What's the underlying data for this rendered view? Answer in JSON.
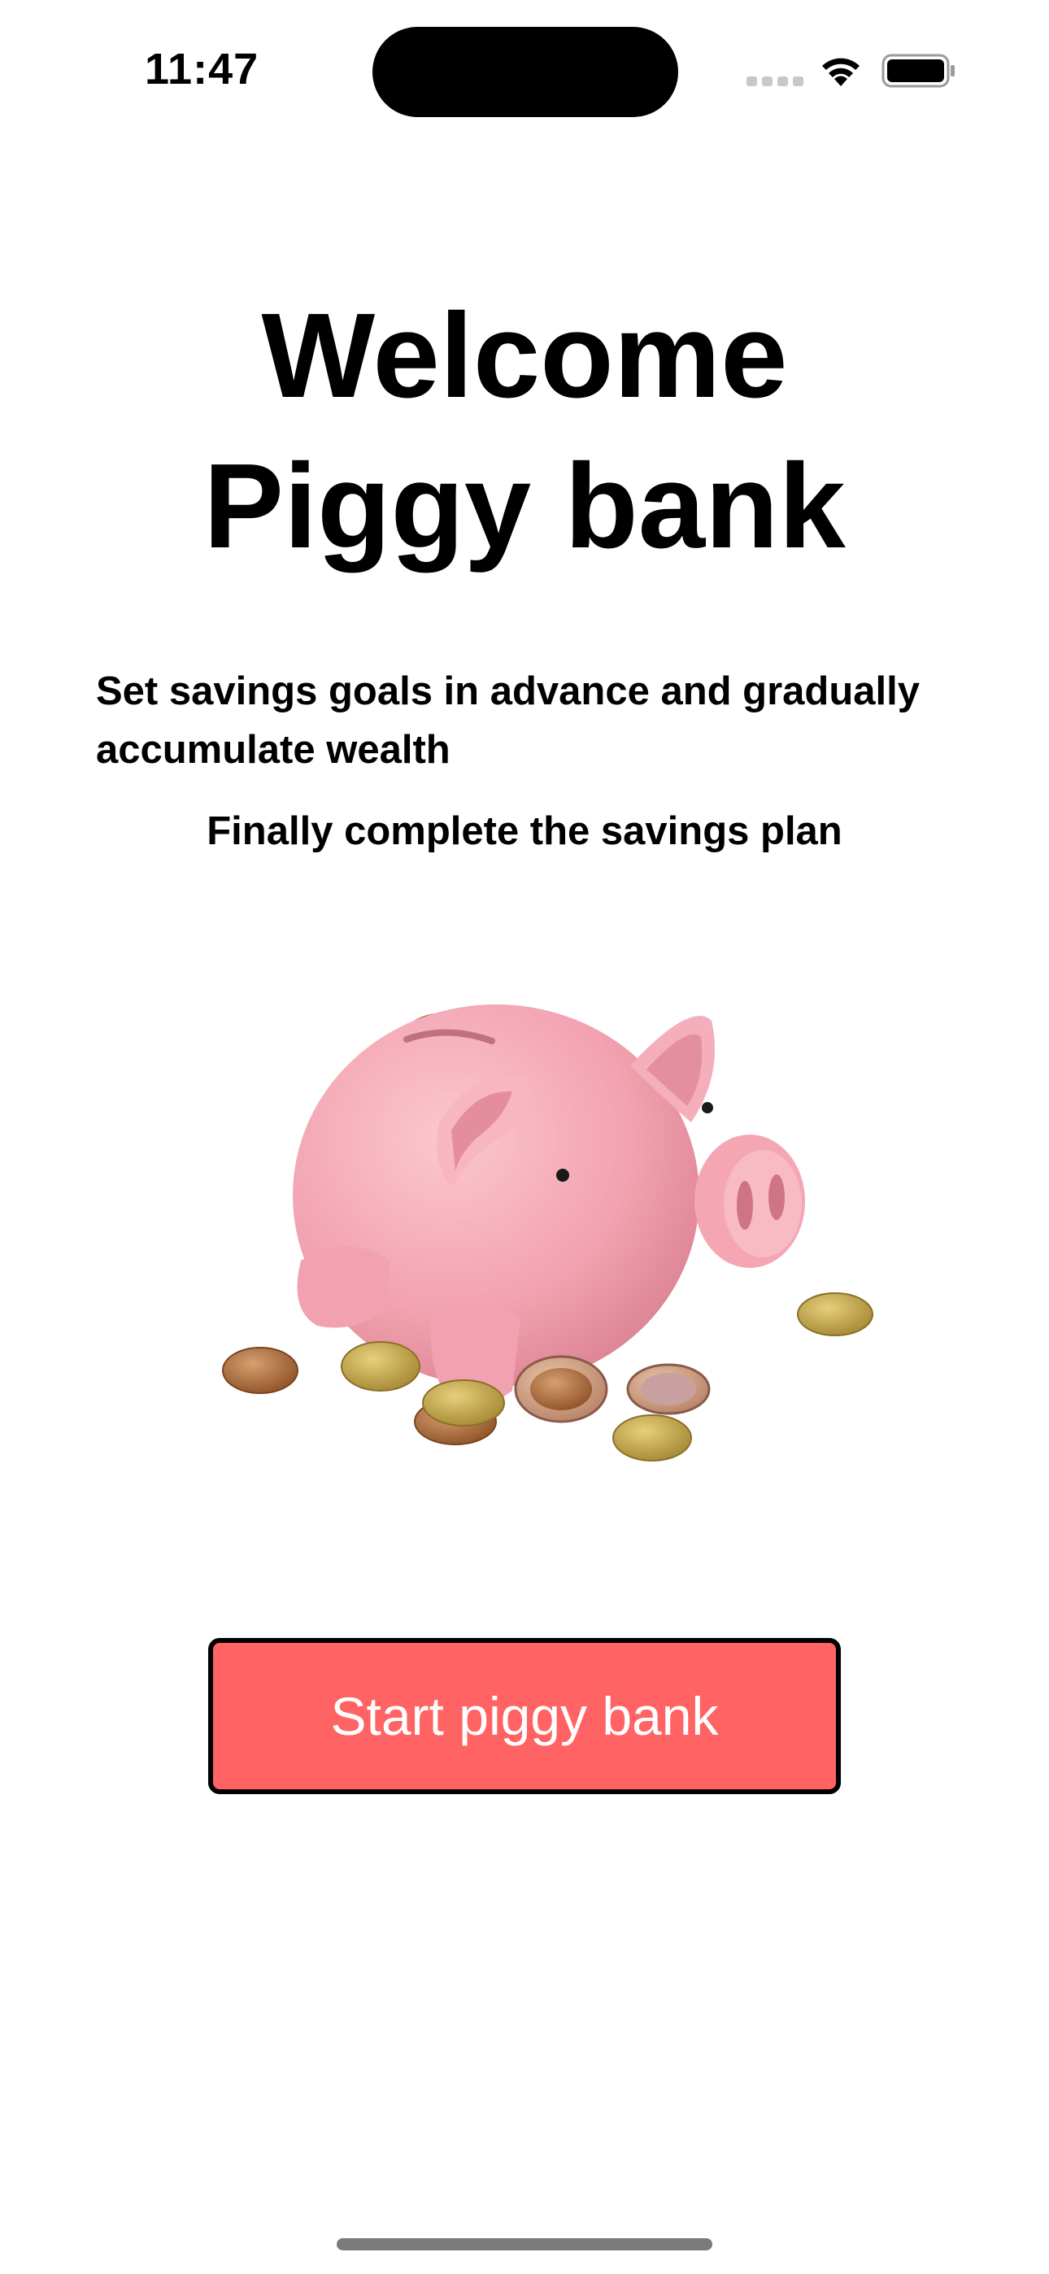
{
  "status_bar": {
    "time": "11:47",
    "icons": [
      "cellular-signal-icon",
      "wifi-icon",
      "battery-icon"
    ]
  },
  "welcome": {
    "title_line1": "Welcome",
    "title_line2": "Piggy bank",
    "description": "Set savings goals in advance and gradually accumulate wealth",
    "subdescription": "Finally complete the savings plan"
  },
  "illustration": {
    "subject": "piggy-bank-with-coins"
  },
  "actions": {
    "start_label": "Start piggy bank"
  },
  "colors": {
    "button_fill": "#ff6363",
    "button_border": "#000000",
    "button_text": "#ffffff",
    "piggy_pink": "#f4a3b1",
    "background": "#ffffff"
  }
}
